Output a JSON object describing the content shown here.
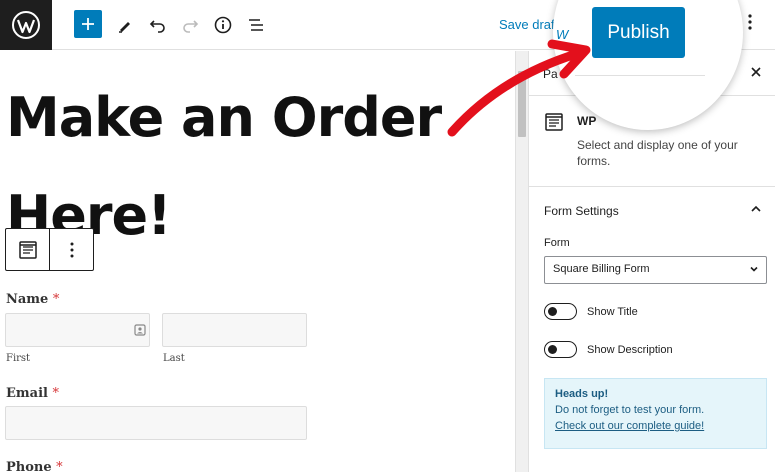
{
  "toolbar": {
    "save_draft": "Save draft",
    "publish": "Publish",
    "w_partial": "W"
  },
  "post": {
    "title": "Make an Order Here!"
  },
  "form": {
    "name_label": "Name",
    "required_mark": "*",
    "first_sub": "First",
    "last_sub": "Last",
    "email_label": "Email",
    "phone_label": "Phone"
  },
  "sidebar": {
    "tab_partial": "Pa",
    "block_name_partial": "WP",
    "block_desc": "Select and display one of your forms.",
    "panel_title": "Form Settings",
    "form_label": "Form",
    "form_selected": "Square Billing Form",
    "show_title": "Show Title",
    "show_description": "Show Description",
    "notice_heading": "Heads up!",
    "notice_text": "Do not forget to test your form.",
    "notice_link": "Check out our complete guide!"
  },
  "colors": {
    "accent": "#007cba",
    "dark": "#1e1e1e",
    "arrow": "#e3101c",
    "notice_bg": "#e5f5fa"
  }
}
